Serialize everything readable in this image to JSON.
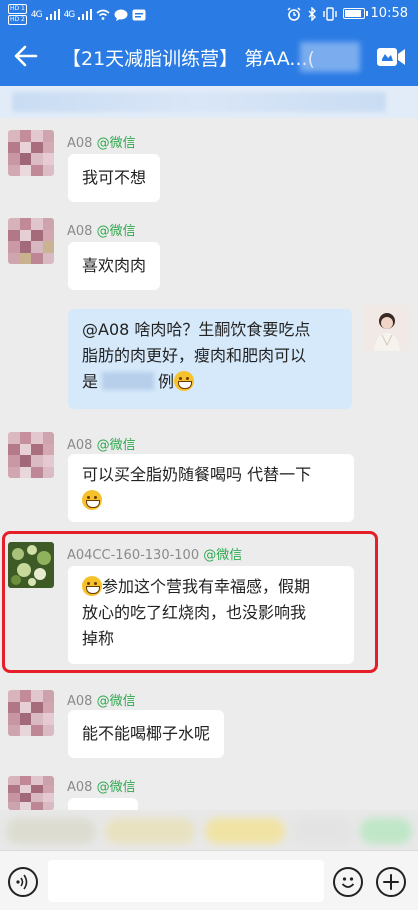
{
  "status_bar": {
    "sim1": "HD 1",
    "sim2": "HD 2",
    "signal1": "4G",
    "signal2": "4G",
    "time": "10:58"
  },
  "header": {
    "title": "【21天减脂训练营】 第AA...(",
    "back_icon": "back-arrow-icon",
    "video_icon": "video-call-icon"
  },
  "colors": {
    "accent": "#2a7be4",
    "source_green": "#2fa84f",
    "highlight_red": "#e51e2a",
    "my_bubble": "#d6e9fb"
  },
  "messages": [
    {
      "sender": "A08",
      "source": "@微信",
      "text": "我可不想"
    },
    {
      "sender": "A08",
      "source": "@微信",
      "text": "喜欢肉肉"
    },
    {
      "self": true,
      "text_1": "@A08  啥肉哈？生酮饮食要吃点",
      "text_2": "脂肪的肉更好，瘦肉和肥肉可以",
      "text_3_pre": "是",
      "text_3_post": "例",
      "emoji": "grin-emoji-icon"
    },
    {
      "sender": "A08",
      "source": "@微信",
      "text_1": "可以买全脂奶随餐喝吗 代替一下",
      "emoji": "laugh-tears-emoji-icon"
    },
    {
      "sender": "A04CC-160-130-100",
      "source": "@微信",
      "text_1": "参加这个营我有幸福感，假期",
      "text_2": "放心的吃了红烧肉，也没影响我",
      "text_3": "掉称",
      "emoji": "grin-sweat-emoji-icon",
      "highlighted": true
    },
    {
      "sender": "A08",
      "source": "@微信",
      "text": "能不能喝椰子水呢"
    },
    {
      "sender": "A08",
      "source": "@微信",
      "text": ""
    }
  ],
  "input_bar": {
    "voice_icon": "voice-icon",
    "emoji_icon": "emoji-icon",
    "plus_icon": "plus-icon",
    "placeholder": ""
  }
}
